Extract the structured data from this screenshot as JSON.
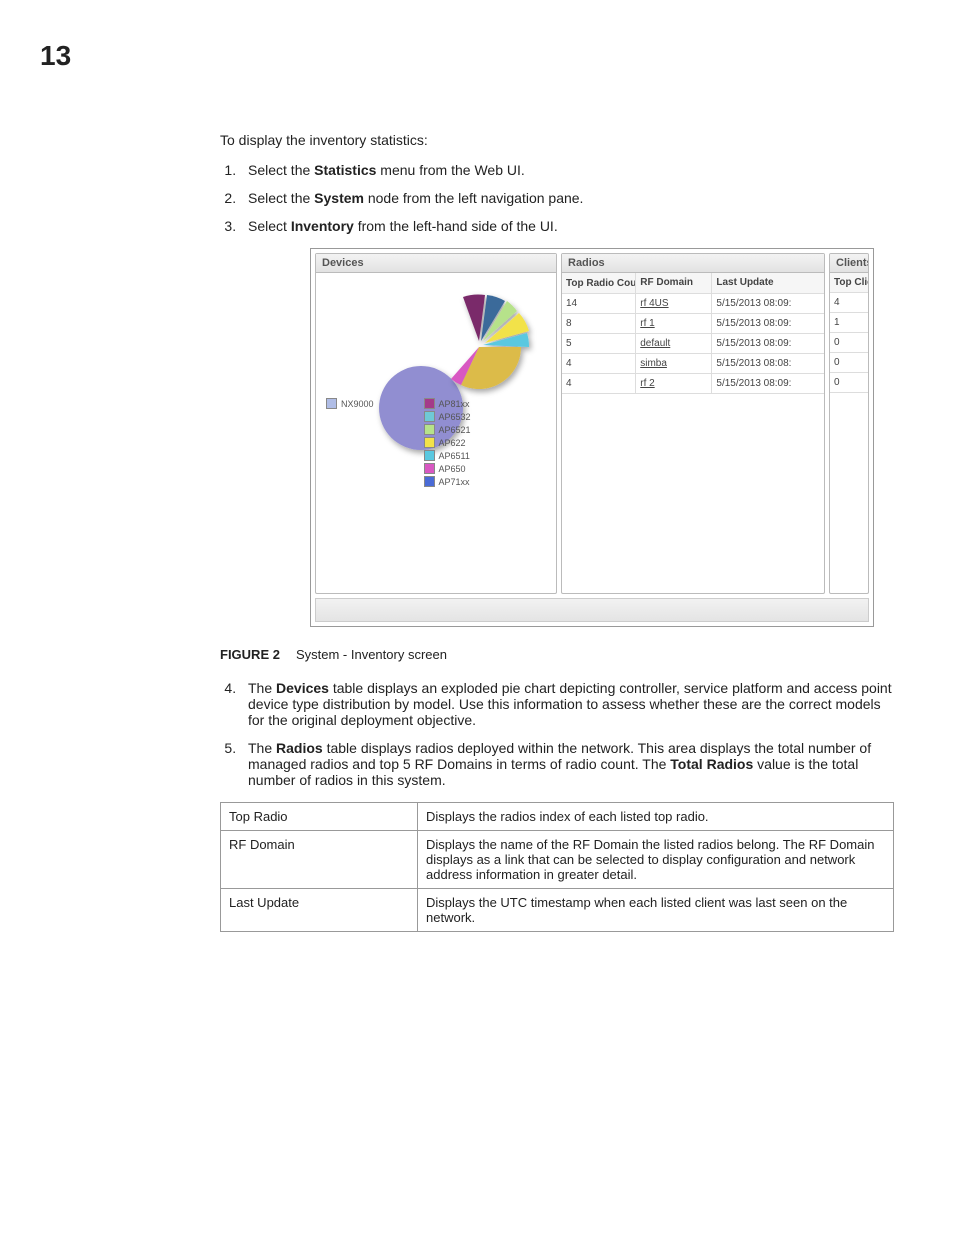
{
  "page_number": "13",
  "intro": "To display the inventory statistics:",
  "steps_first": [
    {
      "pre": "Select the ",
      "bold": "Statistics",
      "post": " menu from the Web UI."
    },
    {
      "pre": "Select the ",
      "bold": "System",
      "post": " node from the left navigation pane."
    },
    {
      "pre": "Select ",
      "bold": "Inventory",
      "post": " from the left-hand side of the UI."
    }
  ],
  "figure": {
    "label": "FIGURE 2",
    "caption": "System - Inventory screen"
  },
  "steps_second": [
    {
      "pre": "The ",
      "bold": "Devices",
      "post": " table displays an exploded pie chart depicting controller, service platform and access point device type distribution by model. Use this information to assess whether these are the correct models for the original deployment objective."
    },
    {
      "pre": "The ",
      "bold": "Radios",
      "post_pre": " table displays radios deployed within the network. This area displays the total number of managed radios and top 5 RF Domains in terms of radio count. The ",
      "bold2": "Total Radios",
      "post": " value is the total number of radios in this system."
    }
  ],
  "panels": {
    "devices_title": "Devices",
    "radios_title": "Radios",
    "clients_title": "Clients",
    "radios_headers": [
      "Top Radio Count",
      "RF Domain",
      "Last Update"
    ],
    "clients_header": "Top Client Count",
    "radios_rows": [
      {
        "count": "14",
        "domain": "rf 4US",
        "update": "5/15/2013 08:09:",
        "client": "4"
      },
      {
        "count": "8",
        "domain": "rf 1",
        "update": "5/15/2013 08:09:",
        "client": "1"
      },
      {
        "count": "5",
        "domain": "default",
        "update": "5/15/2013 08:09:",
        "client": "0"
      },
      {
        "count": "4",
        "domain": "simba",
        "update": "5/15/2013 08:08:",
        "client": "0"
      },
      {
        "count": "4",
        "domain": "rf 2",
        "update": "5/15/2013 08:09:",
        "client": "0"
      }
    ],
    "legend_left": [
      {
        "label": "NX9000",
        "color": "#b0bde6"
      }
    ],
    "legend_right": [
      {
        "label": "AP81xx",
        "color": "#a43a8a"
      },
      {
        "label": "AP6532",
        "color": "#6fc9d6"
      },
      {
        "label": "AP6521",
        "color": "#b6e28a"
      },
      {
        "label": "AP622",
        "color": "#f2e24a"
      },
      {
        "label": "AP6511",
        "color": "#5ac8e0"
      },
      {
        "label": "AP650",
        "color": "#d858c2"
      },
      {
        "label": "AP71xx",
        "color": "#4a6bd6"
      }
    ]
  },
  "chart_data": {
    "type": "pie",
    "title": "Devices",
    "exploded_slice": "NX9000",
    "slices": [
      {
        "label": "NX9000",
        "color": "#918ed1",
        "approx_pct": 36
      },
      {
        "label": "AP71xx",
        "color": "#dcbb4a",
        "approx_pct": 34
      },
      {
        "label": "AP650",
        "color": "#d858c2",
        "approx_pct": 3
      },
      {
        "label": "AP6511",
        "color": "#5ac8e0",
        "approx_pct": 6
      },
      {
        "label": "AP622",
        "color": "#f2e24a",
        "approx_pct": 6
      },
      {
        "label": "AP6521",
        "color": "#b6e28a",
        "approx_pct": 4
      },
      {
        "label": "AP6532",
        "color": "#3a6b9a",
        "approx_pct": 5
      },
      {
        "label": "AP81xx",
        "color": "#7a2a6a",
        "approx_pct": 6
      }
    ]
  },
  "desc_table": [
    {
      "key": "Top Radio",
      "val": "Displays the radios index of each listed top radio."
    },
    {
      "key": "RF Domain",
      "val": "Displays the name of the RF Domain the listed radios belong. The RF Domain displays as a link that can be selected to display configuration and network address information in greater detail."
    },
    {
      "key": "Last Update",
      "val": "Displays the UTC timestamp when each listed client was last seen on the network."
    }
  ]
}
